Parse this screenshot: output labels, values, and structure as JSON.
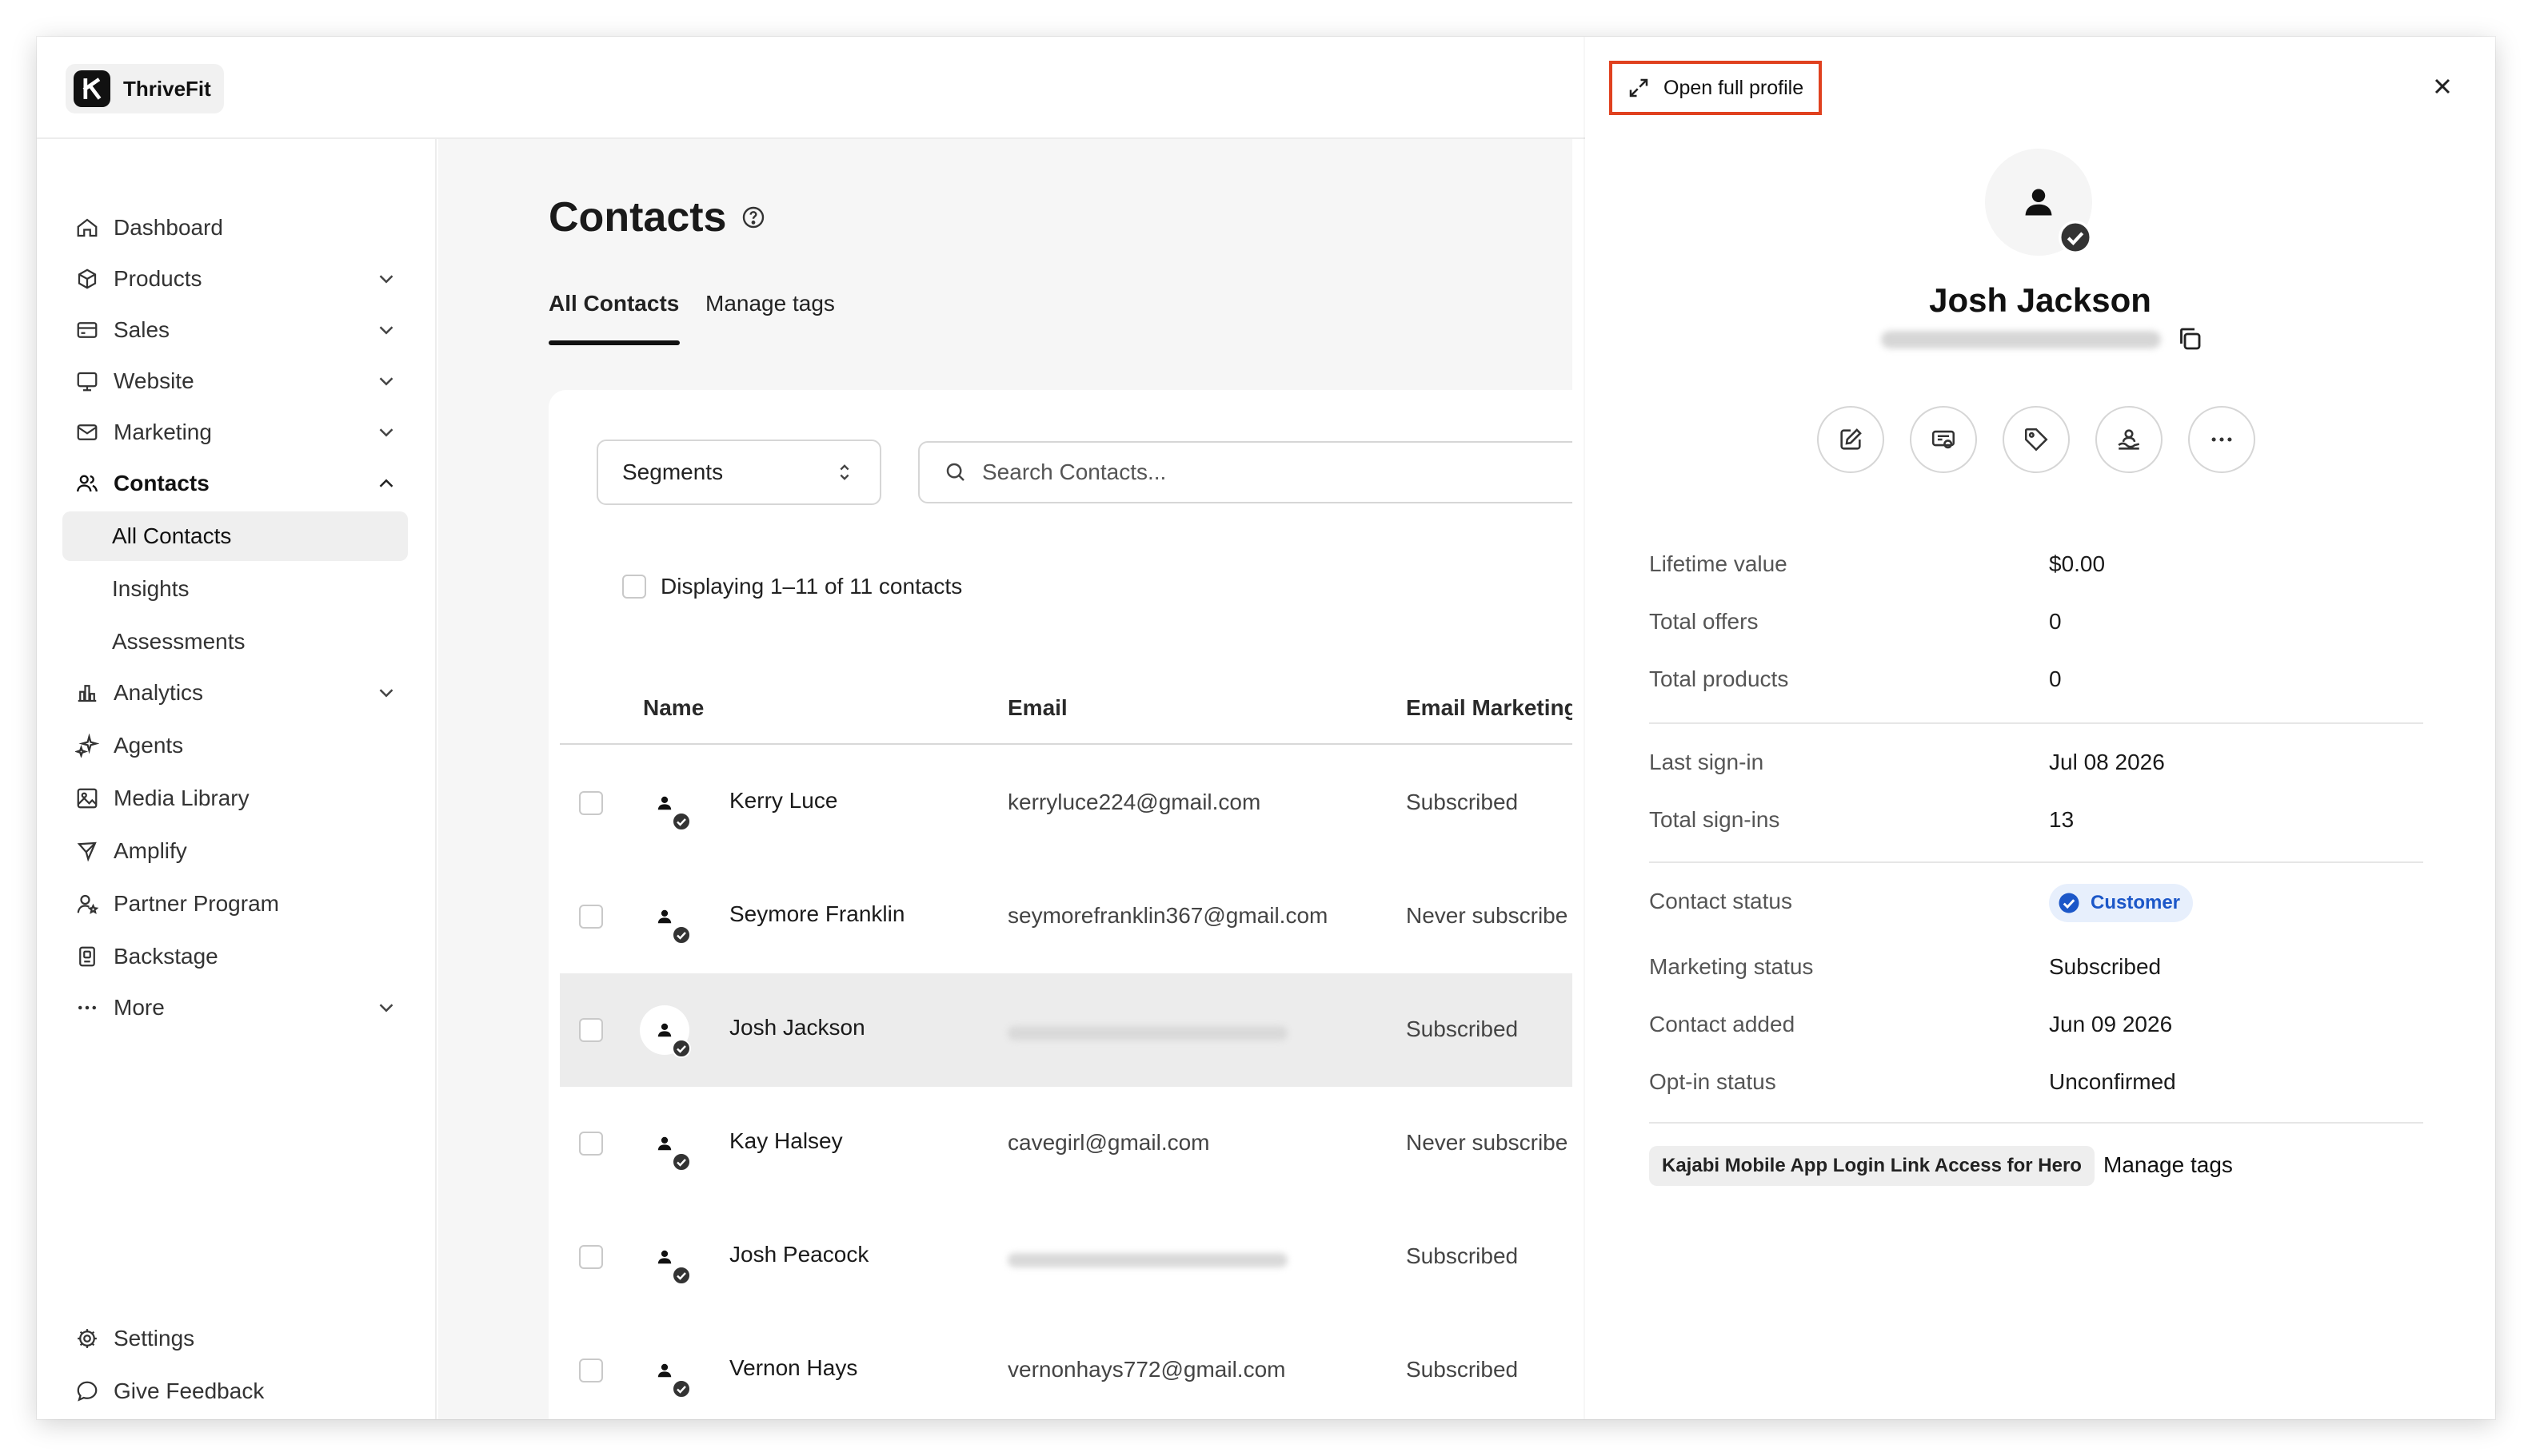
{
  "app": {
    "brand_name": "ThriveFit"
  },
  "sidebar": {
    "items": [
      {
        "label": "Dashboard"
      },
      {
        "label": "Products"
      },
      {
        "label": "Sales"
      },
      {
        "label": "Website"
      },
      {
        "label": "Marketing"
      },
      {
        "label": "Contacts"
      },
      {
        "label": "All Contacts"
      },
      {
        "label": "Insights"
      },
      {
        "label": "Assessments"
      },
      {
        "label": "Analytics"
      },
      {
        "label": "Agents"
      },
      {
        "label": "Media Library"
      },
      {
        "label": "Amplify"
      },
      {
        "label": "Partner Program"
      },
      {
        "label": "Backstage"
      },
      {
        "label": "More"
      }
    ],
    "footer": [
      {
        "label": "Settings"
      },
      {
        "label": "Give Feedback"
      }
    ]
  },
  "main": {
    "title": "Contacts",
    "tabs": [
      {
        "label": "All Contacts"
      },
      {
        "label": "Manage tags"
      }
    ],
    "segments_label": "Segments",
    "search_placeholder": "Search Contacts...",
    "display_text": "Displaying 1–11 of 11 contacts",
    "columns": [
      "Name",
      "Email",
      "Email Marketing"
    ],
    "rows": [
      {
        "name": "Kerry Luce",
        "email": "kerryluce224@gmail.com",
        "marketing": "Subscribed"
      },
      {
        "name": "Seymore Franklin",
        "email": "seymorefranklin367@gmail.com",
        "marketing": "Never subscribe"
      },
      {
        "name": "Josh Jackson",
        "email": "",
        "marketing": "Subscribed"
      },
      {
        "name": "Kay Halsey",
        "email": "cavegirl@gmail.com",
        "marketing": "Never subscribe"
      },
      {
        "name": "Josh Peacock",
        "email": "",
        "marketing": "Subscribed"
      },
      {
        "name": "Vernon Hays",
        "email": "vernonhays772@gmail.com",
        "marketing": "Subscribed"
      }
    ]
  },
  "drawer": {
    "open_full_profile": "Open full profile",
    "name": "Josh Jackson",
    "fields": [
      {
        "label": "Lifetime value",
        "value": "$0.00"
      },
      {
        "label": "Total offers",
        "value": "0"
      },
      {
        "label": "Total products",
        "value": "0"
      },
      {
        "label": "Last sign-in",
        "value": "Jul 08 2026"
      },
      {
        "label": "Total sign-ins",
        "value": "13"
      },
      {
        "label": "Contact status",
        "value": "Customer"
      },
      {
        "label": "Marketing status",
        "value": "Subscribed"
      },
      {
        "label": "Contact added",
        "value": "Jun 09 2026"
      },
      {
        "label": "Opt-in status",
        "value": "Unconfirmed"
      }
    ],
    "tag": "Kajabi Mobile App Login Link Access for Hero",
    "manage_tags": "Manage tags"
  },
  "colors": {
    "highlight_border": "#e0411f",
    "customer_pill_bg": "#e7effc",
    "customer_pill_text": "#1c57c8"
  },
  "icons": {
    "sidebar": [
      "home-icon",
      "box-icon",
      "card-icon",
      "monitor-icon",
      "mail-icon",
      "users-icon",
      "bar-chart-icon",
      "sparkle-icon",
      "image-icon",
      "megaphone-icon",
      "person-star-icon",
      "backstage-icon",
      "dots-icon",
      "gear-icon",
      "chat-icon"
    ],
    "drawer_actions": [
      "edit-icon",
      "offer-icon",
      "tag-icon",
      "community-icon",
      "more-icon"
    ]
  }
}
